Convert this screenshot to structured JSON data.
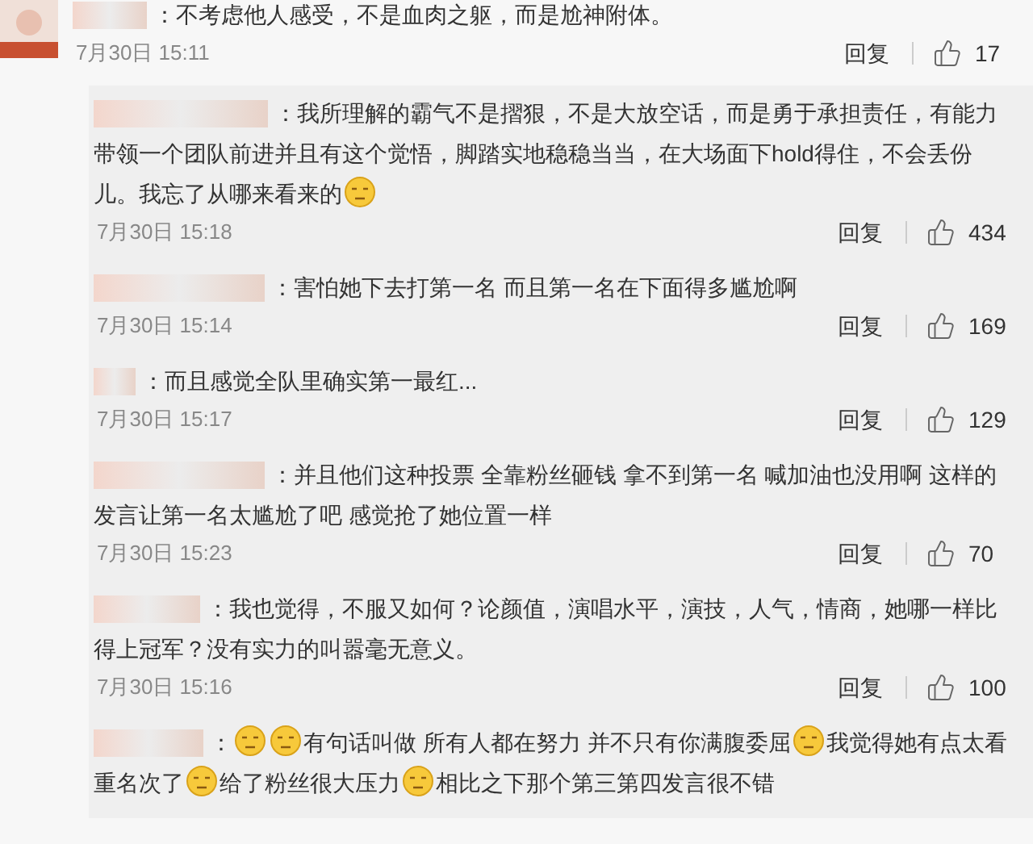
{
  "comments": [
    {
      "segments": [
        {
          "kind": "text",
          "text": "：不考虑他人感受，不是血肉之躯，而是尬神附体。"
        }
      ],
      "date": "7月30日 15:11",
      "reply": "回复",
      "likes": "17"
    },
    {
      "segments": [
        {
          "kind": "text",
          "text": "：我所理解的霸气不是摺狠，不是大放空话，而是勇于承担责任，有能力带领一个团队前进并且有这个觉悟，脚踏实地稳稳当当，在大场面下hold得住，不会丢份儿。我忘了从哪来看来的"
        },
        {
          "kind": "emoji"
        }
      ],
      "date": "7月30日 15:18",
      "reply": "回复",
      "likes": "434"
    },
    {
      "segments": [
        {
          "kind": "text",
          "text": "：害怕她下去打第一名 而且第一名在下面得多尴尬啊"
        }
      ],
      "date": "7月30日 15:14",
      "reply": "回复",
      "likes": "169"
    },
    {
      "segments": [
        {
          "kind": "text",
          "text": "：而且感觉全队里确实第一最红..."
        }
      ],
      "date": "7月30日 15:17",
      "reply": "回复",
      "likes": "129"
    },
    {
      "segments": [
        {
          "kind": "text",
          "text": "：并且他们这种投票 全靠粉丝砸钱 拿不到第一名 喊加油也没用啊 这样的发言让第一名太尴尬了吧 感觉抢了她位置一样"
        }
      ],
      "date": "7月30日 15:23",
      "reply": "回复",
      "likes": "70"
    },
    {
      "segments": [
        {
          "kind": "text",
          "text": "：我也觉得，不服又如何？论颜值，演唱水平，演技，人气，情商，她哪一样比得上冠军？没有实力的叫嚣毫无意义。"
        }
      ],
      "date": "7月30日 15:16",
      "reply": "回复",
      "likes": "100"
    },
    {
      "segments": [
        {
          "kind": "text",
          "text": "："
        },
        {
          "kind": "emoji"
        },
        {
          "kind": "emoji"
        },
        {
          "kind": "text",
          "text": "有句话叫做 所有人都在努力 并不只有你满腹委屈"
        },
        {
          "kind": "emoji"
        },
        {
          "kind": "text",
          "text": "我觉得她有点太看重名次了"
        },
        {
          "kind": "emoji"
        },
        {
          "kind": "text",
          "text": "给了粉丝很大压力"
        },
        {
          "kind": "emoji"
        },
        {
          "kind": "text",
          "text": "相比之下那个第三第四发言很不错"
        }
      ]
    }
  ]
}
